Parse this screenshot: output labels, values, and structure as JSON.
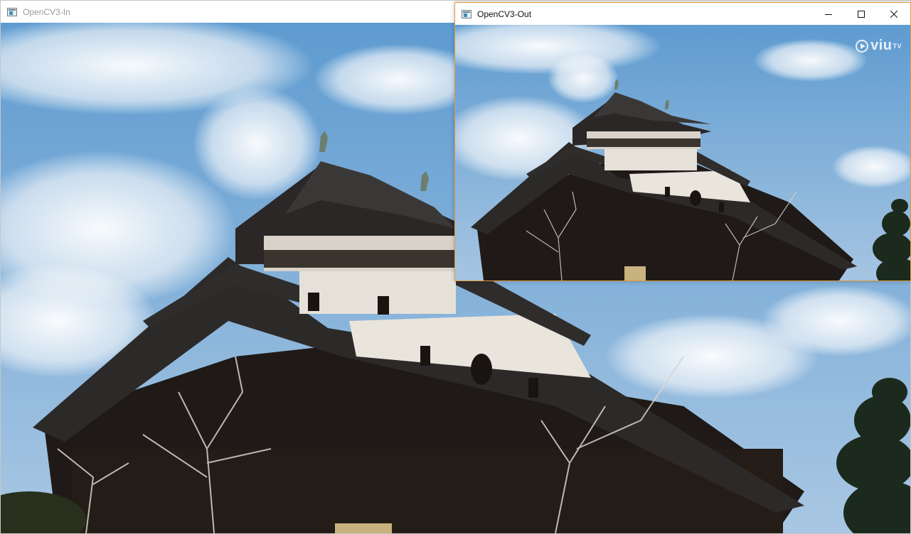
{
  "windows": {
    "input": {
      "title": "OpenCV3-In",
      "icon": "app-window-icon"
    },
    "output": {
      "title": "OpenCV3-Out",
      "icon": "app-window-icon",
      "controls": [
        "minimize-icon",
        "maximize-icon",
        "close-icon"
      ],
      "watermark": {
        "brand": "viu",
        "suffix": "TV"
      }
    }
  },
  "colors": {
    "active_border": "#e39a3b",
    "inactive_title_text": "#9a9a9a",
    "sky": "#6fa6d6"
  }
}
